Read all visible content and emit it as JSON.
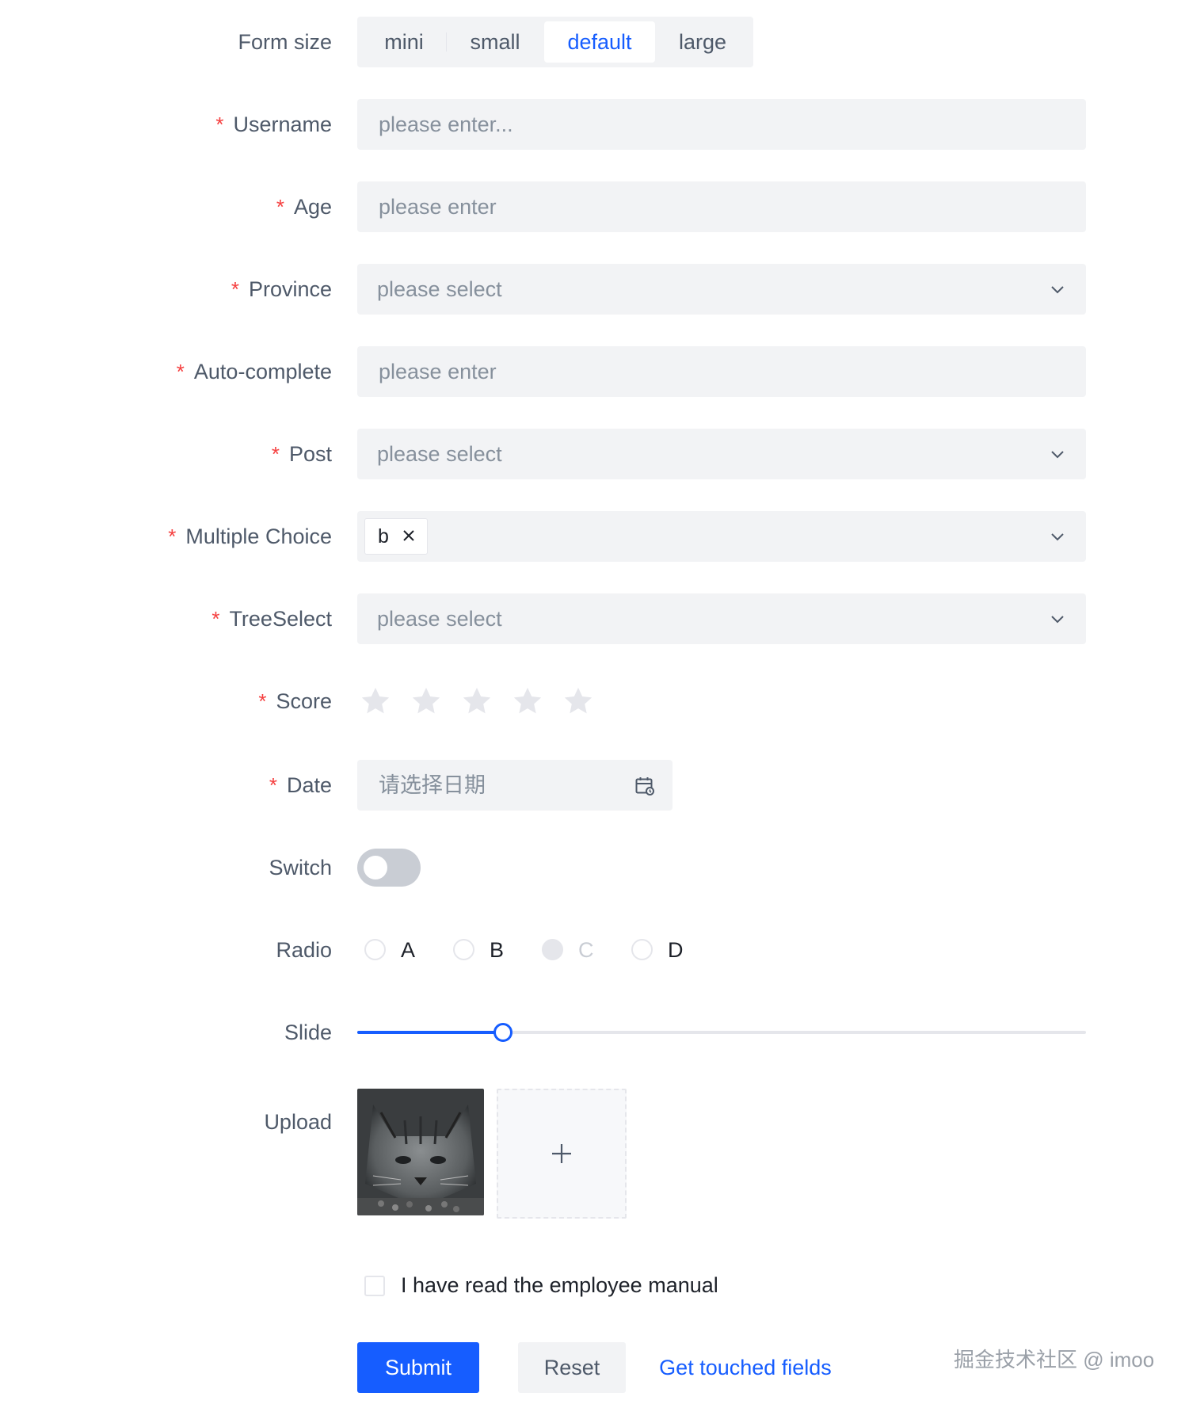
{
  "form_size": {
    "label": "Form size",
    "options": [
      "mini",
      "small",
      "default",
      "large"
    ],
    "selected": "default"
  },
  "fields": {
    "username": {
      "label": "Username",
      "required": "*",
      "placeholder": "please enter..."
    },
    "age": {
      "label": "Age",
      "required": "*",
      "placeholder": "please enter"
    },
    "province": {
      "label": "Province",
      "required": "*",
      "placeholder": "please select"
    },
    "autocomplete": {
      "label": "Auto-complete",
      "required": "*",
      "placeholder": "please enter"
    },
    "post": {
      "label": "Post",
      "required": "*",
      "placeholder": "please select"
    },
    "multiple": {
      "label": "Multiple Choice",
      "required": "*",
      "tags": [
        "b"
      ]
    },
    "treeselect": {
      "label": "TreeSelect",
      "required": "*",
      "placeholder": "please select"
    },
    "score": {
      "label": "Score",
      "required": "*",
      "value": 0,
      "max": 5
    },
    "date": {
      "label": "Date",
      "required": "*",
      "placeholder": "请选择日期"
    },
    "switch": {
      "label": "Switch",
      "checked": false
    },
    "radio": {
      "label": "Radio",
      "options": [
        "A",
        "B",
        "C",
        "D"
      ],
      "disabled": [
        "C"
      ]
    },
    "slide": {
      "label": "Slide",
      "value": 20,
      "min": 0,
      "max": 100
    },
    "upload": {
      "label": "Upload",
      "add_symbol": "+"
    }
  },
  "agreement": {
    "label": "I have read the employee manual",
    "checked": false
  },
  "buttons": {
    "submit": "Submit",
    "reset": "Reset",
    "touched": "Get touched fields"
  },
  "colors": {
    "primary": "#165dff",
    "required": "#f53f3f",
    "fill": "#f2f3f5"
  },
  "watermark": "掘金技术社区 @ imoo"
}
